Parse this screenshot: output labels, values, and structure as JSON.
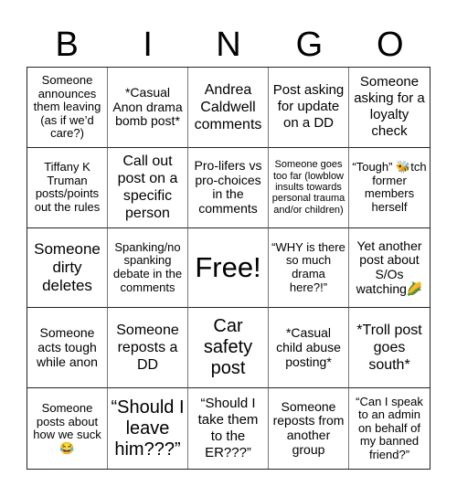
{
  "header": {
    "letters": [
      "B",
      "I",
      "N",
      "G",
      "O"
    ]
  },
  "cells": [
    "Someone announces them leaving (as if we’d care?)",
    "*Casual Anon drama bomb post*",
    "Andrea Caldwell comments",
    "Post asking for update on a DD",
    "Someone asking for a loyalty check",
    "Tiffany K Truman posts/points out the rules",
    "Call out post on a specific person",
    "Pro-lifers vs pro-choices in the comments",
    "Someone goes too far (lowblow insults towards personal trauma and/or children)",
    "“Tough” 🐝tch former members herself",
    "Someone dirty deletes",
    "Spanking/no spanking debate in the comments",
    "Free!",
    "“WHY is there so much drama here?!”",
    "Yet another post about S/Os watching🌽",
    "Someone acts tough while anon",
    "Someone reposts a DD",
    "Car safety post",
    "*Casual child abuse posting*",
    "*Troll post goes south*",
    "Someone posts about how we suck 😂",
    "“Should I leave him???”",
    "“Should I take them to the ER???”",
    "Someone reposts from another group",
    "“Can I speak to an admin on behalf of my banned friend?”"
  ]
}
